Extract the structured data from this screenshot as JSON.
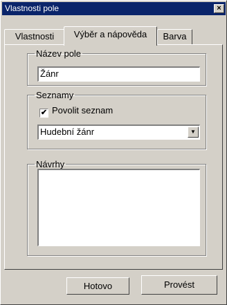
{
  "window": {
    "title": "Vlastnosti pole",
    "close_glyph": "×"
  },
  "tabs": [
    {
      "label": "Vlastnosti"
    },
    {
      "label": "Výběr a nápověda",
      "active": true
    },
    {
      "label": "Barva"
    }
  ],
  "field_name": {
    "legend": "Název pole",
    "value": "Žánr"
  },
  "lists": {
    "legend": "Seznamy",
    "enable_label": "Povolit seznam",
    "enabled": true,
    "check_glyph": "✔",
    "selected": "Hudební žánr",
    "dropdown_glyph": "▼"
  },
  "suggestions": {
    "legend": "Návrhy",
    "value": ""
  },
  "buttons": {
    "ok": "Hotovo",
    "apply": "Provést"
  }
}
